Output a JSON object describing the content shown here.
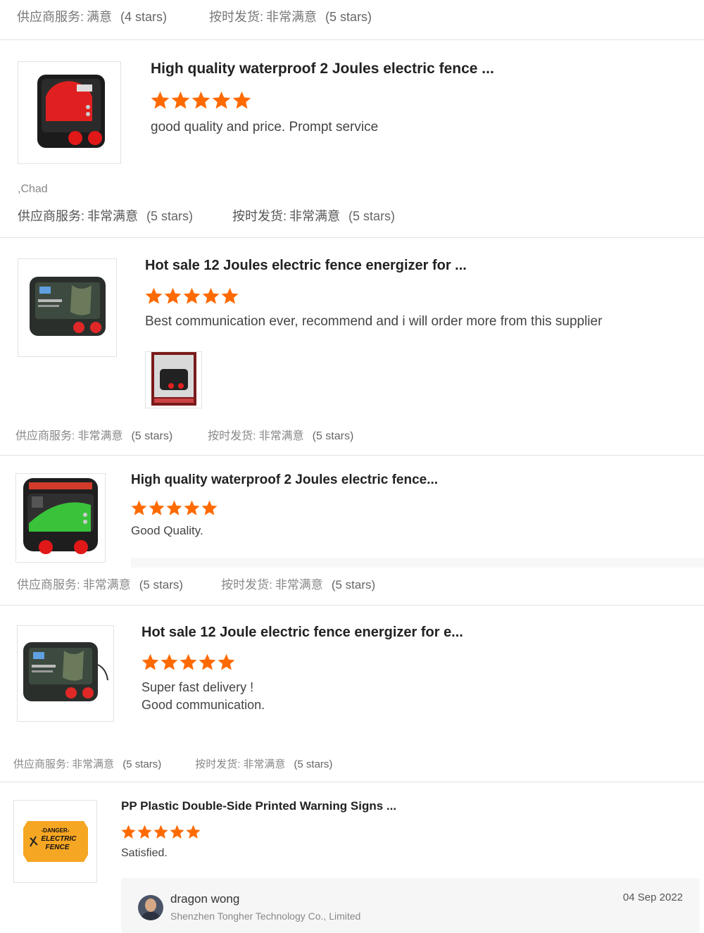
{
  "ratings_rows": [
    {
      "supplier_label": "供应商服务:",
      "supplier_value": "满意",
      "supplier_stars": "(4 stars)",
      "ontime_label": "按时发货:",
      "ontime_value": "非常满意",
      "ontime_stars": "(5 stars)"
    },
    {
      "supplier_label": "供应商服务:",
      "supplier_value": "非常满意",
      "supplier_stars": "(5 stars)",
      "ontime_label": "按时发货:",
      "ontime_value": "非常满意",
      "ontime_stars": "(5 stars)"
    },
    {
      "supplier_label": "供应商服务:",
      "supplier_value": "非常满意",
      "supplier_stars": "(5 stars)",
      "ontime_label": "按时发货:",
      "ontime_value": "非常满意",
      "ontime_stars": "(5 stars)"
    },
    {
      "supplier_label": "供应商服务:",
      "supplier_value": "非常满意",
      "supplier_stars": "(5 stars)",
      "ontime_label": "按时发货:",
      "ontime_value": "非常满意",
      "ontime_stars": "(5 stars)"
    },
    {
      "supplier_label": "供应商服务:",
      "supplier_value": "非常满意",
      "supplier_stars": "(5 stars)",
      "ontime_label": "按时发货:",
      "ontime_value": "非常满意",
      "ontime_stars": "(5 stars)"
    }
  ],
  "reviews": [
    {
      "product_title": "High quality waterproof 2 Joules electric fence ...",
      "rating": 5,
      "text": "good quality and price. Prompt service",
      "reviewer": ",Chad",
      "icon": "energizer-red-icon"
    },
    {
      "product_title": "Hot sale 12 Joules electric fence energizer for ...",
      "rating": 5,
      "text": "Best communication ever, recommend and i will order more from this supplier",
      "icon": "energizer-screen-icon",
      "attachment_icon": "review-photo-icon"
    },
    {
      "product_title": "High quality waterproof 2 Joules electric fence...",
      "rating": 5,
      "text": "Good Quality.",
      "icon": "energizer-green-icon"
    },
    {
      "product_title": "Hot sale 12 Joule electric fence energizer for e...",
      "rating": 5,
      "text_line1": "Super fast delivery !",
      "text_line2": "Good communication.",
      "icon": "energizer-screen-icon"
    },
    {
      "product_title": "PP Plastic Double-Side Printed Warning Signs ...",
      "rating": 5,
      "text": "Satisfied.",
      "icon": "warning-sign-icon",
      "sign_line1": "-DANGER-",
      "sign_line2": "ELECTRIC",
      "sign_line3": "FENCE"
    }
  ],
  "reply": {
    "name": "dragon wong",
    "company": "Shenzhen Tongher Technology Co., Limited",
    "date": "04 Sep 2022"
  },
  "colors": {
    "star": "#ff6a00",
    "text": "#333333",
    "muted": "#888888"
  }
}
